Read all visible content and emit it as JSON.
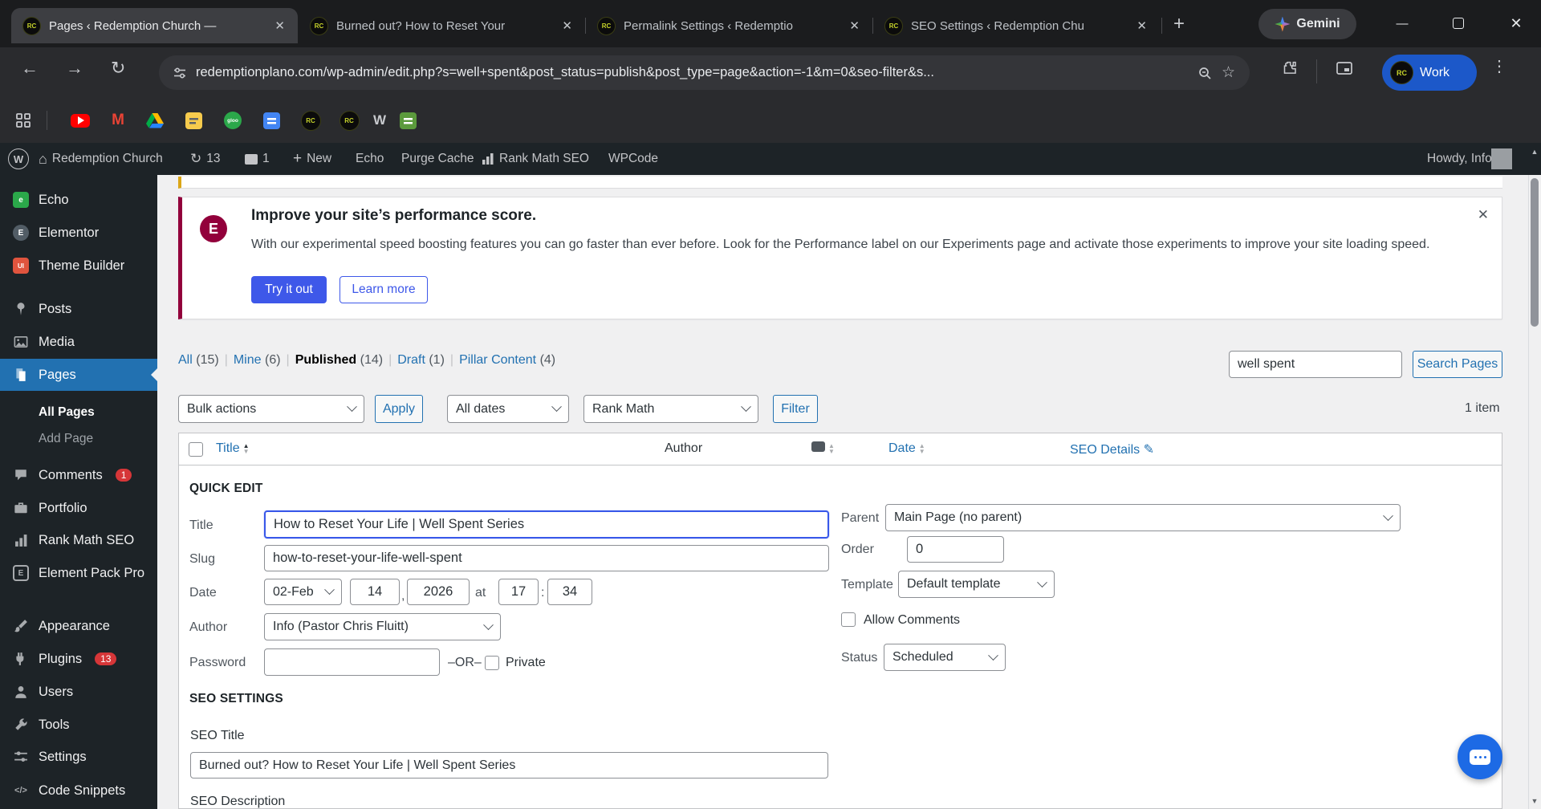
{
  "browser": {
    "tabs": [
      {
        "title": "Pages ‹ Redemption Church —"
      },
      {
        "title": "Burned out? How to Reset Your"
      },
      {
        "title": "Permalink Settings ‹ Redemptio"
      },
      {
        "title": "SEO Settings ‹ Redemption Chu"
      }
    ],
    "gemini_label": "Gemini",
    "url": "redemptionplano.com/wp-admin/edit.php?s=well+spent&post_status=publish&post_type=page&action=-1&m=0&seo-filter&s...",
    "profile_label": "Work"
  },
  "icons": {
    "rc_text": "RC",
    "close": "✕",
    "plus": "+",
    "minimize": "—",
    "back": "←",
    "forward": "→",
    "reload": "↻",
    "star": "☆",
    "dots": "⋮",
    "home": "⌂",
    "updates": "↻",
    "sort_up": "▲",
    "sort_down": "▼",
    "pencil": "✎",
    "gloo_text": "gloo",
    "w_text": "W",
    "gmail_text": "M",
    "elementor_letter": "E",
    "theme_builder_letters": "UI",
    "echo_letter": "e",
    "element_pack_letter": "E",
    "code_glyph": "</>",
    "wordpress_letter": "W",
    "up_arrow": "▲",
    "down_arrow": "▼"
  },
  "adminbar": {
    "site": "Redemption Church",
    "update_count": "13",
    "comment_count": "1",
    "new": "New",
    "echo": "Echo",
    "purge": "Purge Cache",
    "rankmath": "Rank Math SEO",
    "wpcode": "WPCode",
    "howdy": "Howdy, Info"
  },
  "sidebar": {
    "items": [
      {
        "label": "Echo"
      },
      {
        "label": "Elementor"
      },
      {
        "label": "Theme Builder"
      },
      {
        "label": "Posts"
      },
      {
        "label": "Media"
      },
      {
        "label": "Pages"
      },
      {
        "label": "Comments",
        "badge": "1"
      },
      {
        "label": "Portfolio"
      },
      {
        "label": "Rank Math SEO"
      },
      {
        "label": "Element Pack Pro"
      },
      {
        "label": "Appearance"
      },
      {
        "label": "Plugins",
        "badge": "13"
      },
      {
        "label": "Users"
      },
      {
        "label": "Tools"
      },
      {
        "label": "Settings"
      },
      {
        "label": "Code Snippets"
      }
    ],
    "submenu": [
      {
        "label": "All Pages"
      },
      {
        "label": "Add Page"
      }
    ]
  },
  "notice": {
    "heading": "Improve your site’s performance score.",
    "body": "With our experimental speed boosting features you can go faster than ever before. Look for the Performance label on our Experiments page and activate those experiments to improve your site loading speed.",
    "primary": "Try it out",
    "secondary": "Learn more",
    "close": "✕"
  },
  "filters": {
    "all": "All",
    "all_count": "(15)",
    "mine": "Mine",
    "mine_count": "(6)",
    "published": "Published",
    "published_count": "(14)",
    "draft": "Draft",
    "draft_count": "(1)",
    "pillar": "Pillar Content",
    "pillar_count": "(4)"
  },
  "search": {
    "value": "well spent",
    "button": "Search Pages",
    "item_count": "1 item"
  },
  "bulk": {
    "bulk_actions": "Bulk actions",
    "apply": "Apply",
    "all_dates": "All dates",
    "seo_filter": "Rank Math",
    "filter": "Filter"
  },
  "table": {
    "title": "Title",
    "author": "Author",
    "date": "Date",
    "seo_details": "SEO Details"
  },
  "quickedit": {
    "section": "QUICK EDIT",
    "title_label": "Title",
    "title_value": "How to Reset Your Life | Well Spent Series",
    "slug_label": "Slug",
    "slug_value": "how-to-reset-your-life-well-spent",
    "date_label": "Date",
    "month": "02-Feb",
    "day": "14",
    "comma": ",",
    "year": "2026",
    "at": "at",
    "hour": "17",
    "colon": ":",
    "minute": "34",
    "author_label": "Author",
    "author_value": "Info (Pastor Chris Fluitt)",
    "password_label": "Password",
    "or": "–OR–",
    "private": "Private",
    "parent_label": "Parent",
    "parent_value": "Main Page (no parent)",
    "order_label": "Order",
    "order_value": "0",
    "template_label": "Template",
    "template_value": "Default template",
    "allow_comments": "Allow Comments",
    "status_label": "Status",
    "status_value": "Scheduled"
  },
  "seo": {
    "section": "SEO SETTINGS",
    "title_label": "SEO Title",
    "title_value": "Burned out? How to Reset Your Life | Well Spent Series",
    "desc_label": "SEO Description"
  },
  "colors": {
    "wp_blue": "#2271b1",
    "focus_blue": "#3858e9",
    "elementor_crimson": "#92003b",
    "badge_red": "#d63638",
    "primary_button": "#3e58e9",
    "profile_blue": "#1c58c9",
    "fab_blue": "#1d6ae5"
  }
}
